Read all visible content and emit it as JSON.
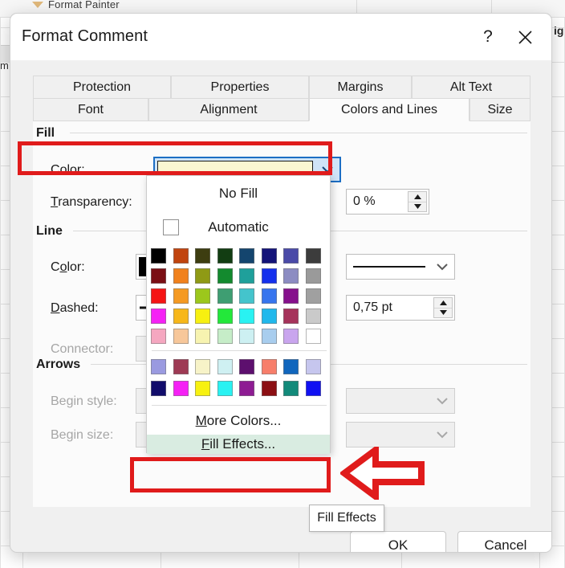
{
  "background": {
    "ribbon_button_label": "Format Painter",
    "row_header_label": "m",
    "right_tab_label": "ig"
  },
  "dialog": {
    "title": "Format Comment",
    "help_icon": "question-mark-icon",
    "close_icon": "close-icon",
    "tabs_row1": [
      {
        "label": "Protection",
        "active": false
      },
      {
        "label": "Properties",
        "active": false
      },
      {
        "label": "Margins",
        "active": false
      },
      {
        "label": "Alt Text",
        "active": false
      }
    ],
    "tabs_row2": [
      {
        "label": "Font",
        "active": false
      },
      {
        "label": "Alignment",
        "active": false
      },
      {
        "label": "Colors and Lines",
        "active": true
      },
      {
        "label": "Size",
        "active": false
      }
    ],
    "groups": {
      "fill": "Fill",
      "line": "Line",
      "arrows": "Arrows"
    },
    "fields": {
      "fill_color_label": "Color:",
      "fill_color_accel": "C",
      "fill_color_value": "#FAF7D2",
      "transparency_label": "Transparency:",
      "transparency_accel": "T",
      "transparency_value": "0 %",
      "line_color_label": "Color:",
      "line_color_accel": "o",
      "line_color_value": "#000000",
      "line_style_value": "solid-line",
      "dashed_label": "Dashed:",
      "dashed_accel": "D",
      "weight_value": "0,75 pt",
      "connector_label": "Connector:",
      "begin_style_label": "Begin style:",
      "begin_size_label": "Begin size:"
    },
    "buttons": {
      "ok": "OK",
      "cancel": "Cancel"
    }
  },
  "color_dropdown": {
    "no_fill": "No Fill",
    "automatic": "Automatic",
    "more_colors": "More Colors...",
    "more_colors_accel": "M",
    "fill_effects": "Fill Effects...",
    "fill_effects_accel": "F",
    "fill_effects_highlighted": true,
    "theme_rows": [
      [
        "#000000",
        "#C1440E",
        "#3D3D10",
        "#123D12",
        "#14456E",
        "#131379",
        "#4A4AA8",
        "#3C3C3C"
      ],
      [
        "#7B0E14",
        "#F1811C",
        "#8F9A15",
        "#138A2E",
        "#1FA09B",
        "#1430ED",
        "#8C8CC2",
        "#9A9A9A"
      ],
      [
        "#F51414",
        "#F59A22",
        "#9CC71C",
        "#3E9E72",
        "#44C4CC",
        "#3775EE",
        "#86108C",
        "#A0A0A0"
      ],
      [
        "#F521F5",
        "#F7B71A",
        "#F7F010",
        "#23E83A",
        "#29F2F2",
        "#20B8EC",
        "#A6335B",
        "#CACACA"
      ],
      [
        "#F5A7C0",
        "#F7C79A",
        "#F7F3B0",
        "#C6EDC8",
        "#CDF0F2",
        "#A8CDEE",
        "#C9A5EE",
        "#FFFFFF"
      ]
    ],
    "recent_rows": [
      [
        "#9A9AE0",
        "#9E3A54",
        "#F7F3C8",
        "#CFF0F2",
        "#5D0F6E",
        "#F77E6A",
        "#1166BD",
        "#C6C6EE"
      ],
      [
        "#110C6B",
        "#F520F5",
        "#F7F110",
        "#29F2F2",
        "#8E1C93",
        "#8C0F13",
        "#128A7A",
        "#1010F2"
      ]
    ]
  },
  "annotations": {
    "highlight_color_row": true,
    "highlight_fill_effects": true,
    "arrow_icon": "left-arrow-icon",
    "arrow_color": "#E01B1B",
    "tooltip": "Fill Effects"
  }
}
